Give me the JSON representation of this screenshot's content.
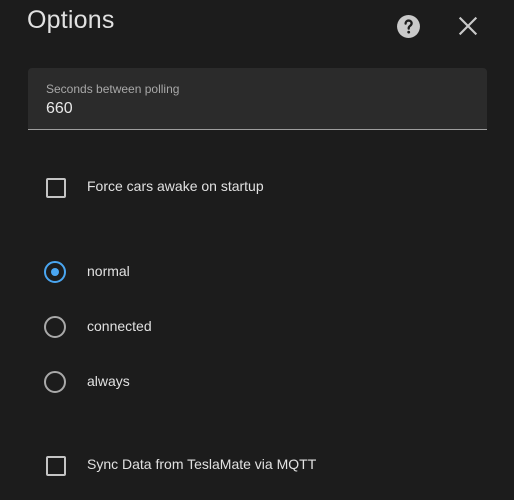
{
  "dialog": {
    "title": "Options"
  },
  "polling": {
    "label": "Seconds between polling",
    "value": "660"
  },
  "force_awake": {
    "label": "Force cars awake on startup",
    "checked": false
  },
  "polling_policy": {
    "options": [
      {
        "label": "normal",
        "selected": true
      },
      {
        "label": "connected",
        "selected": false
      },
      {
        "label": "always",
        "selected": false
      }
    ]
  },
  "sync_mqtt": {
    "label": "Sync Data from TeslaMate via MQTT",
    "checked": false
  },
  "colors": {
    "background": "#1c1c1c",
    "field_background": "#2b2b2b",
    "accent": "#4aa6f1",
    "text": "#e1e1e1"
  },
  "icons": {
    "help": "help-circle-icon",
    "close": "close-icon"
  }
}
